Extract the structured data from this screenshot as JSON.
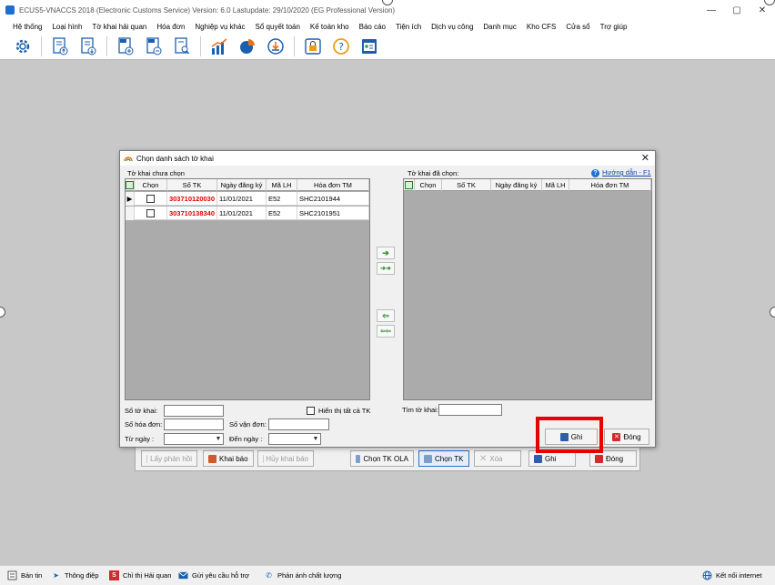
{
  "window": {
    "title": "ECUS5-VNACCS 2018 (Electronic Customs Service) Version: 6.0 Lastupdate: 29/10/2020 (EG Professional Version)",
    "controls": [
      "—",
      "▢",
      "✕"
    ]
  },
  "menu": [
    "Hệ thống",
    "Loại hình",
    "Tờ khai hải quan",
    "Hóa đơn",
    "Nghiệp vụ khác",
    "Sổ quyết toán",
    "Kế toán kho",
    "Báo cáo",
    "Tiện ích",
    "Dịch vụ công",
    "Danh mục",
    "Kho CFS",
    "Cửa sổ",
    "Trợ giúp"
  ],
  "toolbar_icons": [
    "settings-gear",
    "export-declaration",
    "import-declaration",
    "invoice-add",
    "invoice-edit",
    "invoice-search",
    "bar-chart",
    "pie-chart",
    "download",
    "lock",
    "help",
    "id-card"
  ],
  "dialog": {
    "title": "Chọn danh sách tờ khai",
    "left_group_label": "Tờ khai chưa chọn",
    "right_group_label": "Tờ khai đã chọn:",
    "help_link": "Hướng dẫn - F1",
    "columns": [
      "",
      "Chọn",
      "Số TK",
      "Ngày đăng ký",
      "Mã LH",
      "Hóa đơn TM"
    ],
    "rows": [
      {
        "so_tk": "303710120030",
        "ngay": "11/01/2021",
        "ma_lh": "E52",
        "hoa_don": "SHC2101944"
      },
      {
        "so_tk": "303710138340",
        "ngay": "11/01/2021",
        "ma_lh": "E52",
        "hoa_don": "SHC2101951"
      }
    ],
    "arrows": [
      "➔",
      "➔➔",
      "⇦",
      "⇦⇦"
    ],
    "filters": {
      "so_to_khai": "Số tờ khai:",
      "so_hoa_don": "Số hóa đơn:",
      "so_van_don": "Số vận đơn:",
      "tu_ngay": "Từ ngày :",
      "den_ngay": "Đến ngày :",
      "show_all": "Hiển thị tất cả TK",
      "tim_to_khai": "Tìm tờ khai:"
    },
    "save_label": "Ghi",
    "close_label": "Đóng"
  },
  "back_panel": {
    "buttons": [
      "Lấy phản hồi",
      "Khai báo",
      "Hủy khai báo",
      "Chọn TK OLA",
      "Chọn TK",
      "Xóa",
      "Ghi",
      "Đóng"
    ]
  },
  "status_bar": [
    "Bản tin",
    "Thông điệp",
    "Chỉ thị Hải quan",
    "Gửi yêu cầu hỗ trợ",
    "Phản ánh chất lượng",
    "Kết nối internet"
  ]
}
